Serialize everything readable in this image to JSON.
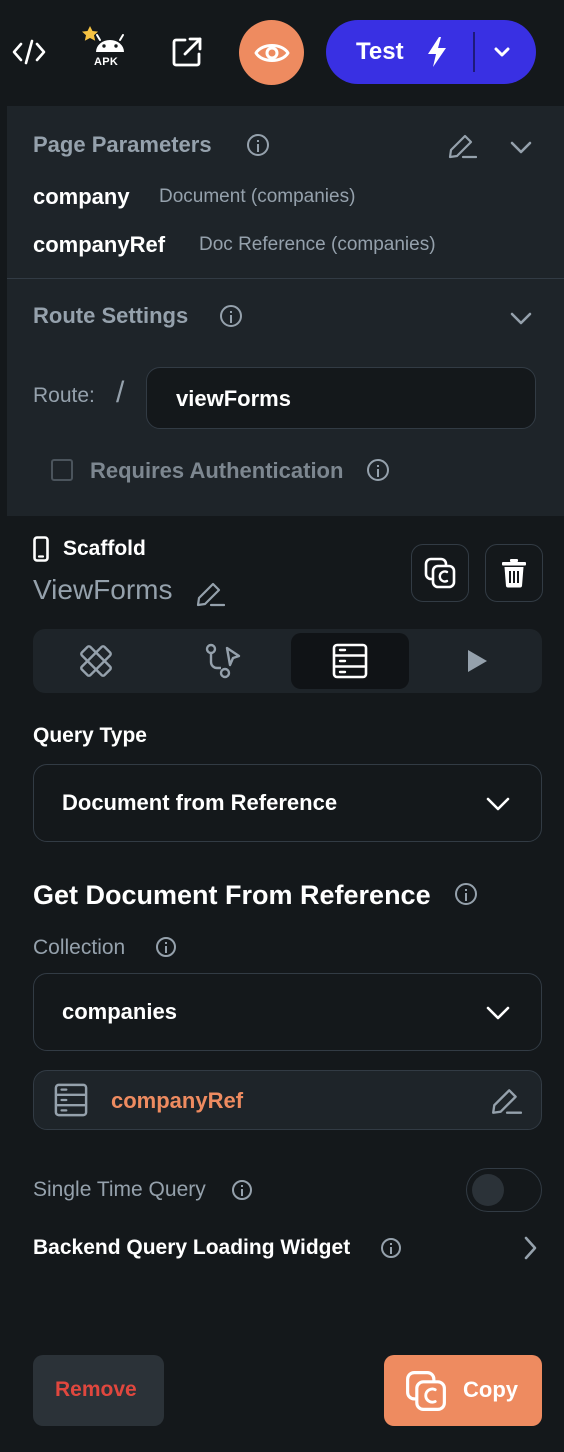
{
  "toolbar": {
    "apk_label": "APK",
    "test_label": "Test"
  },
  "page_parameters": {
    "title": "Page Parameters",
    "params": [
      {
        "name": "company",
        "type": "Document (companies)"
      },
      {
        "name": "companyRef",
        "type": "Doc Reference (companies)"
      }
    ]
  },
  "route_settings": {
    "title": "Route Settings",
    "route_label": "Route:",
    "route_slash": "/",
    "route_value": "viewForms",
    "requires_auth_label": "Requires Authentication"
  },
  "scaffold": {
    "label": "Scaffold",
    "page_name": "ViewForms"
  },
  "query": {
    "type_label": "Query Type",
    "type_value": "Document from Reference",
    "heading": "Get Document From Reference",
    "collection_label": "Collection",
    "collection_value": "companies",
    "reference_value": "companyRef",
    "single_time_label": "Single Time Query",
    "loading_widget_label": "Backend Query Loading Widget"
  },
  "footer": {
    "remove_label": "Remove",
    "copy_label": "Copy"
  },
  "colors": {
    "background": "#14181b",
    "panel": "#1e2429",
    "accent_orange": "#ee8b60",
    "accent_blue": "#3930e3",
    "danger": "#e0473e",
    "muted_text": "#95a1ac"
  }
}
